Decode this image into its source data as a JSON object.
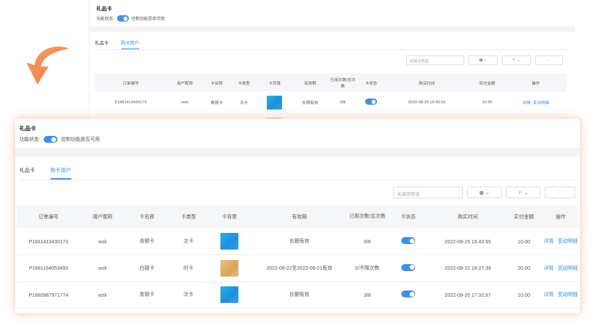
{
  "title": "礼品卡",
  "state_label": "功能状态:",
  "state_desc": "控制功能是否可用",
  "tabs": [
    "礼品卡",
    "购卡用户"
  ],
  "active_tab": "购卡用户",
  "search": {
    "placeholder": "关键词筛选"
  },
  "toolbar": {
    "grid_icon": "grid-icon",
    "filter_icon": "flag-icon",
    "refresh_icon": "refresh-icon"
  },
  "columns": [
    "订单编号",
    "用户昵称",
    "卡名称",
    "卡类型",
    "卡背景",
    "有效期",
    "已用次数/总次数",
    "卡状态",
    "购买时间",
    "实付金额",
    "操作"
  ],
  "rows": [
    {
      "order": "P1661413430173",
      "user": "wzk",
      "card": "青铜卡",
      "type": "次卡",
      "bg": "blue",
      "validity": "长期有效",
      "usage": "0/8",
      "enabled": true,
      "time": "2022-08-25 15:43:55",
      "amount": "10.00",
      "op1": "详情",
      "op2": "变动明细"
    },
    {
      "order": "P1661164053493",
      "user": "wzk",
      "card": "白银卡",
      "type": "时卡",
      "bg": "gold",
      "validity": "2022-08-22至2022-09-21有效",
      "usage": "0/不限次数",
      "enabled": true,
      "time": "2022-08-22 18:27:39",
      "amount": "20.00",
      "op1": "详情",
      "op2": "变动明细"
    },
    {
      "order": "P1660987971774",
      "user": "wzk",
      "card": "青铜卡",
      "type": "次卡",
      "bg": "blue",
      "validity": "长期有效",
      "usage": "3/8",
      "enabled": true,
      "time": "2022-08-20 17:32:57",
      "amount": "10.00",
      "op1": "详情",
      "op2": "变动明细"
    }
  ],
  "bg_preview": {
    "title": "礼品卡",
    "state_label": "功能状态:",
    "state_desc": "控制功能是否可用",
    "tabs": [
      "礼品卡",
      "购卡用户"
    ],
    "search_placeholder": "关键词筛选",
    "columns": [
      "订单编号",
      "用户昵称",
      "卡名称",
      "卡类型",
      "卡背景",
      "有效期",
      "已用次数/总次数",
      "卡状态",
      "购买时间",
      "实付金额",
      "操作"
    ],
    "row": {
      "order": "P1661413430173",
      "user": "wzk",
      "card": "青铜卡",
      "type": "次卡",
      "validity": "长期有效",
      "usage": "0/8",
      "time": "2022-08-25 15:43:55",
      "amount": "10.00",
      "op1": "详情",
      "op2": "变动明细"
    }
  },
  "colors": {
    "accent": "#3d8ef0",
    "arrow": "#f08a4b",
    "glow": "#f5965a"
  }
}
